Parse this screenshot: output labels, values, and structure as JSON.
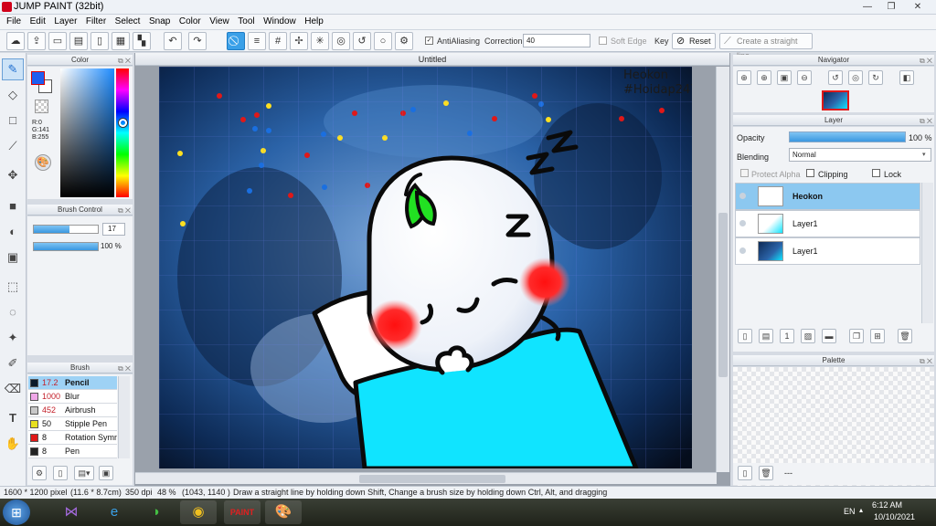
{
  "window": {
    "title": "JUMP PAINT (32bit)",
    "minimize": "—",
    "maximize": "❐",
    "close": "✕"
  },
  "menu": [
    "File",
    "Edit",
    "Layer",
    "Filter",
    "Select",
    "Snap",
    "Color",
    "View",
    "Tool",
    "Window",
    "Help"
  ],
  "toolbar": {
    "antialiasing_label": "AntiAliasing",
    "correction_label": "Correction",
    "correction_value": "40",
    "soft_edge_label": "Soft Edge",
    "key_label": "Key",
    "reset_label": "Reset",
    "straight_line_label": "Create a straight line"
  },
  "color_panel": {
    "title": "Color",
    "r": "R:0",
    "g": "G:141",
    "b": "B:255"
  },
  "brush_control": {
    "title": "Brush Control",
    "size": "17",
    "opacity": "100 %",
    "opacity_level": 1.0
  },
  "brush_panel": {
    "title": "Brush",
    "items": [
      {
        "size": "17.2",
        "name": "Pencil",
        "swatch": "#0a1a2a"
      },
      {
        "size": "1000",
        "name": "Blur",
        "swatch": "#f0a8e8"
      },
      {
        "size": "452",
        "name": "Airbrush",
        "swatch": "#c8c8c8"
      },
      {
        "size": "50",
        "name": "Stipple Pen",
        "swatch": "#e8e020"
      },
      {
        "size": "8",
        "name": "Rotation Symm",
        "swatch": "#e01818"
      },
      {
        "size": "8",
        "name": "Pen",
        "swatch": "#222222"
      }
    ]
  },
  "document": {
    "tab_title": "Untitled",
    "watermark_line1": "Heokon",
    "watermark_line2": "#Hoidap247"
  },
  "navigator": {
    "title": "Navigator"
  },
  "layer_panel": {
    "title": "Layer",
    "opacity_label": "Opacity",
    "opacity_value": "100 %",
    "opacity_level": 1.0,
    "blending_label": "Blending",
    "blending_value": "Normal",
    "protect_alpha": "Protect Alpha",
    "clipping": "Clipping",
    "lock": "Lock",
    "layers": [
      {
        "name": "Heokon",
        "active": true
      },
      {
        "name": "Layer1",
        "active": false
      },
      {
        "name": "Layer1",
        "active": false
      }
    ]
  },
  "palette": {
    "title": "Palette",
    "dashes": "---"
  },
  "status": {
    "image_size": "1600 * 1200 pixel",
    "cm_size": "(11.6 * 8.7cm)",
    "dpi": "350 dpi",
    "zoom": "48 %",
    "coords": "(1043, 1140 )",
    "hint": "Draw a straight line by holding down Shift, Change a brush size by holding down Ctrl, Alt, and dragging"
  },
  "taskbar": {
    "lang": "EN",
    "time": "6:12 AM",
    "date": "10/10/2021"
  },
  "colors": {
    "accent": "#3aa0e8",
    "primary_color": "#1e5ff0",
    "layer_active": "#8cc8f0"
  }
}
